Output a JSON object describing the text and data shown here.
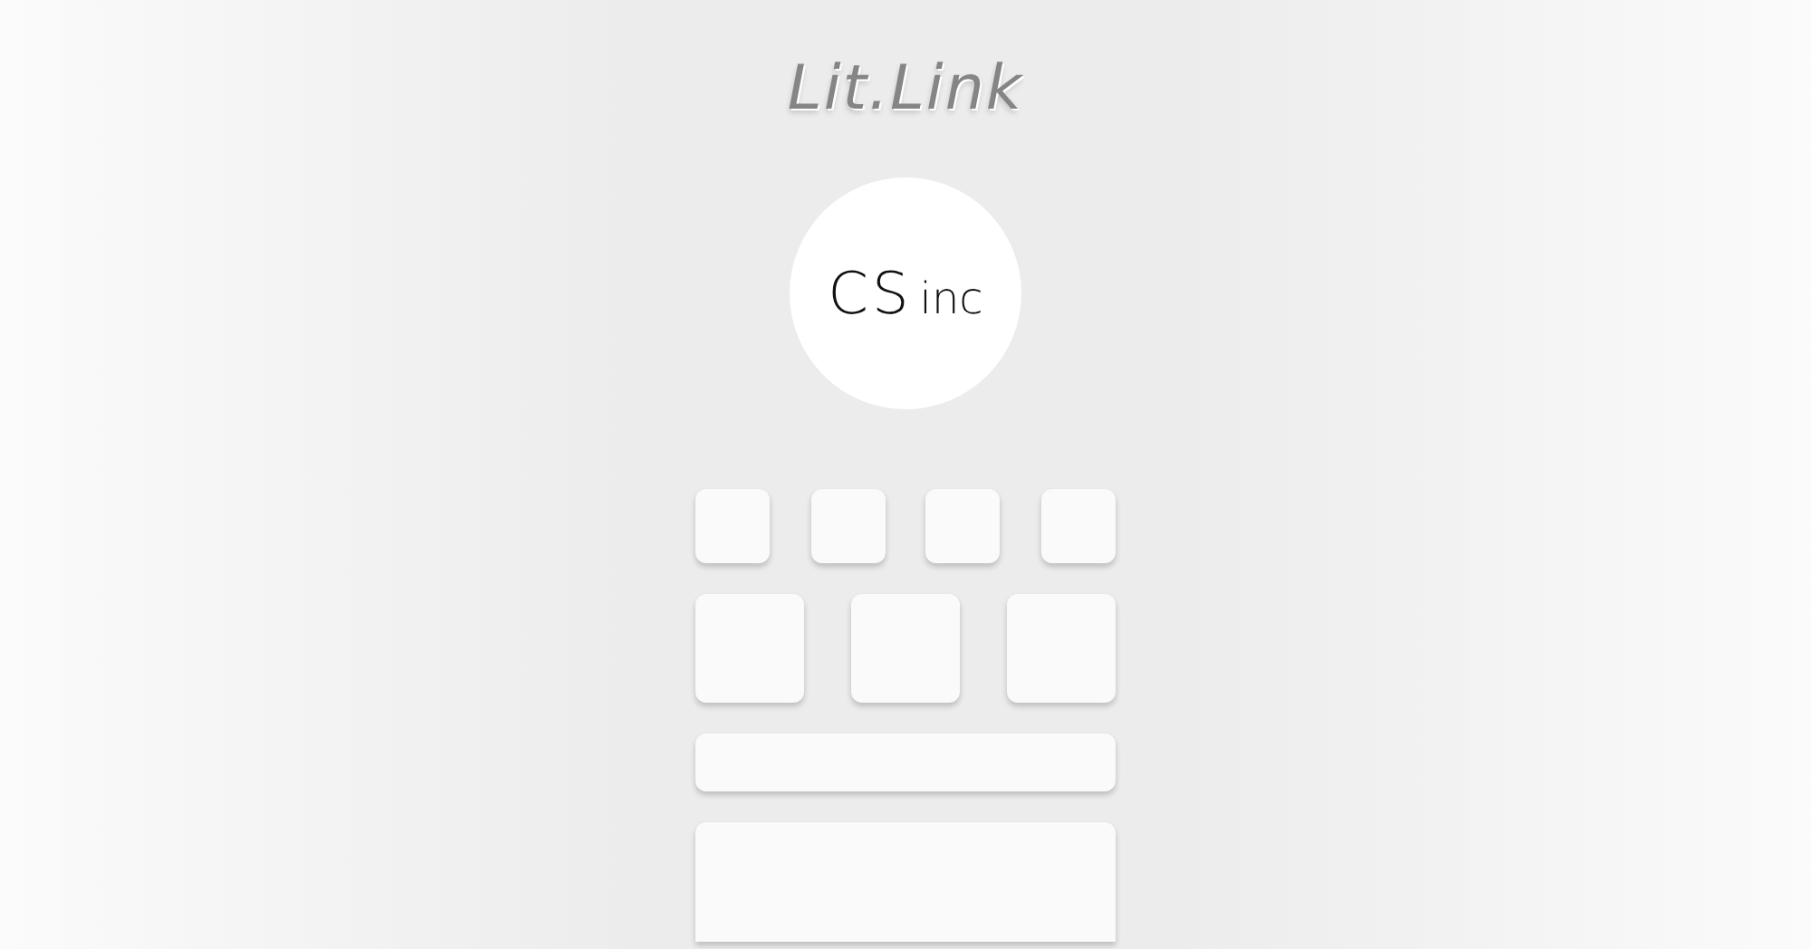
{
  "logo": {
    "text": "Lit.Link"
  },
  "avatar": {
    "name": "CS",
    "suffix": "inc"
  },
  "placeholders": [
    {
      "kind": "small"
    },
    {
      "kind": "small"
    },
    {
      "kind": "small"
    },
    {
      "kind": "small"
    },
    {
      "kind": "medium"
    },
    {
      "kind": "medium"
    },
    {
      "kind": "medium"
    },
    {
      "kind": "bar"
    },
    {
      "kind": "panel"
    }
  ]
}
